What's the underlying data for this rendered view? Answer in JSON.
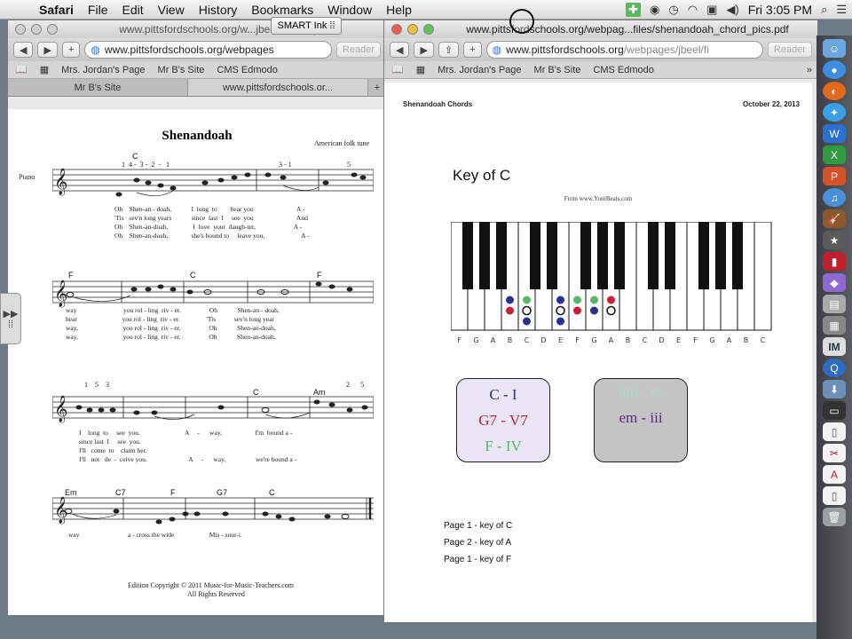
{
  "menubar": {
    "app_name": "Safari",
    "items": [
      "File",
      "Edit",
      "View",
      "History",
      "Bookmarks",
      "Window",
      "Help"
    ],
    "clock": "Fri 3:05 PM"
  },
  "smart_ink": "SMART Ink",
  "left_window": {
    "title": "www.pittsfordschools.org/w...jbeel/f...ahc.pdf",
    "url": "www.pittsfordschools.org/webpages",
    "reader": "Reader",
    "bookmarks": [
      "Mrs. Jordan's Page",
      "Mr B's Site",
      "CMS Edmodo"
    ],
    "tabs": [
      "Mr B's Site",
      "www.pittsfordschools.or..."
    ],
    "sheet": {
      "title": "Shenandoah",
      "subtitle": "American folk tune",
      "instrument": "Piano",
      "copyright_1": "Edition Copyright © 2011 Music-for-Music-Teachers.com",
      "copyright_2": "All Rights Reserved",
      "sys1": {
        "chords": [
          "C"
        ],
        "fingering": "1  4 -  3 -  2  -   1",
        "fingering2": "3 - 1",
        "fingering3": "5",
        "lyrics": [
          "Oh    Shen-an - doah,            I  long  to        hear you                          A -",
          "'Tis   sev'n long years            since  last  I     see  you                          And",
          "Oh    Shen-an-doah,               I  love  your  daugh-ter,                       A -",
          "Oh    Shen-an-doah,              she's bound to     leave you,                      A -"
        ]
      },
      "sys2": {
        "chords": [
          "F",
          "C",
          "F"
        ],
        "lyrics": [
          "way                            you rol - ling  riv - er.                 Oh            Shen-an - doah,",
          "hear                           you rol - ling  riv - er.                'Tis           sev'n long year",
          "way,                           you rol - ling  riv - er.                 Oh            Shen-an-doah,",
          "way,                           you rol - ling  riv - er.                 Oh            Shen-an-doah,"
        ]
      },
      "sys3": {
        "chords": [
          "C",
          "Am"
        ],
        "fingering": "1    5    3",
        "fingering2": "2      5",
        "lyrics": [
          "I    long  to     see  you.                           A     -      way,                    I'm  bound a -",
          "since last  I     see  you.",
          "I'll   come  to    claim her.",
          "I'll   not   de  -  ceive you.                         A     -      way,                  we're bound a -"
        ]
      },
      "sys4": {
        "chords": [
          "Em",
          "C7",
          "F",
          "G7",
          "C"
        ],
        "lyrics": [
          "way                             a - cross the wide                     Mis - sour-i."
        ]
      }
    }
  },
  "right_window": {
    "title": "www.pittsfordschools.org/webpag...files/shenandoah_chord_pics.pdf",
    "url_main": "www.pittsfordschools.org",
    "url_rest": "/webpages/jbeel/fi",
    "reader": "Reader",
    "bookmarks": [
      "Mrs. Jordan's Page",
      "Mr B's Site",
      "CMS Edmodo"
    ],
    "pdf": {
      "header_left": "Shenandoah Chords",
      "header_right": "October 22, 2013",
      "heading": "Key of C",
      "source": "From www.YourBeats.com",
      "key_labels": [
        "F",
        "G",
        "A",
        "B",
        "C",
        "D",
        "E",
        "F",
        "G",
        "A",
        "B",
        "C",
        "D",
        "E",
        "F",
        "G",
        "A",
        "B",
        "C"
      ],
      "box1": {
        "lines": [
          "C - I",
          "G7 - V7",
          "F - IV"
        ],
        "colors": [
          "#2b2f8f",
          "#c8203a",
          "#58b868"
        ]
      },
      "box2": {
        "lines": [
          "am - vi",
          "em - iii"
        ],
        "colors": [
          "#9fe0c8",
          "#5a2a86"
        ]
      },
      "page_links": [
        "Page 1 - key of C",
        "Page 2 - key of A",
        "Page 1 - key of F"
      ]
    }
  },
  "dock": {
    "icons": [
      "finder-icon",
      "chrome-icon",
      "firefox-icon",
      "safari-icon",
      "word-icon",
      "excel-icon",
      "powerpoint-icon",
      "itunes-icon",
      "guitar-icon",
      "imovie-icon",
      "photobooth-icon",
      "smart-icon",
      "preview-icon",
      "calculator-icon",
      "im-icon",
      "quicktime-icon",
      "downloads-icon",
      "screenshot-icon",
      "document-icon",
      "pdf-icon",
      "pdf2-icon",
      "file-icon",
      "trash-icon"
    ]
  },
  "colors": {
    "note_navy": "#2b2f8f",
    "note_red": "#c8203a",
    "note_green": "#58b868"
  }
}
